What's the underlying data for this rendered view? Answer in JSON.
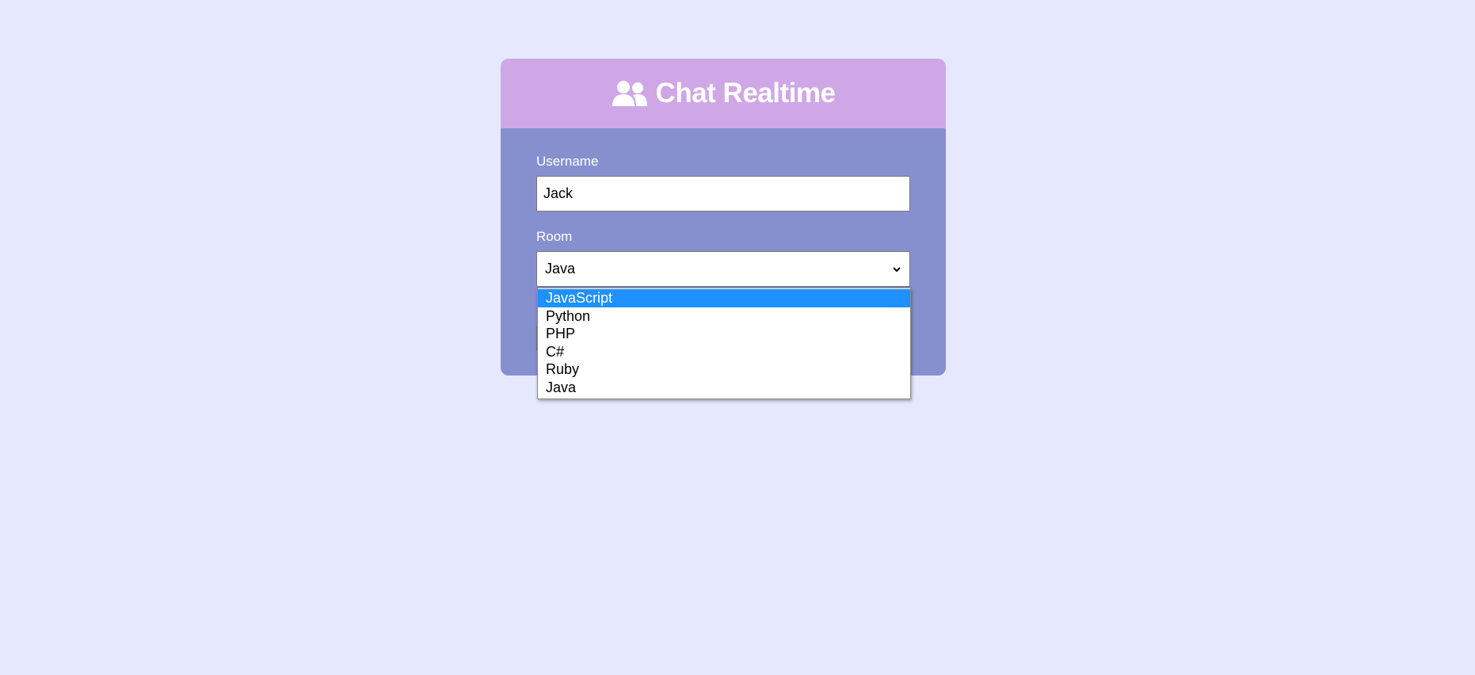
{
  "header": {
    "title": "Chat Realtime",
    "icon": "users-icon"
  },
  "form": {
    "username_label": "Username",
    "username_value": "Jack",
    "room_label": "Room",
    "room_value": "Java"
  },
  "dropdown": {
    "options": [
      {
        "label": "JavaScript",
        "highlighted": true
      },
      {
        "label": "Python",
        "highlighted": false
      },
      {
        "label": "PHP",
        "highlighted": false
      },
      {
        "label": "C#",
        "highlighted": false
      },
      {
        "label": "Ruby",
        "highlighted": false
      },
      {
        "label": "Java",
        "highlighted": false
      }
    ]
  },
  "colors": {
    "background": "#e6e9fd",
    "header": "#cfa7e7",
    "panel": "#8790cf",
    "highlight": "#1e90ff"
  }
}
